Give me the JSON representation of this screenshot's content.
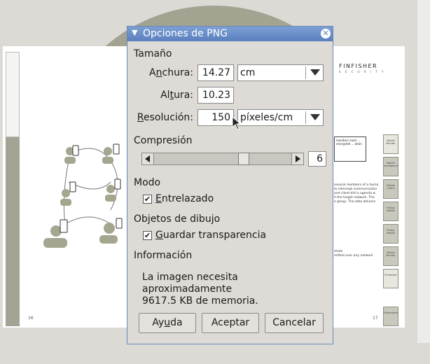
{
  "document": {
    "brand": "FINFISHER",
    "brand_sub": "S E C U R I T Y",
    "page_left_number": "16",
    "page_right_number": "17",
    "callout_text": "monitors most ... encrypted ... ation",
    "body_lines": [
      "several members of a huma",
      "to intercept communicatior",
      "and client did is agenda w",
      "h the target network. The",
      "e group. The data delivers"
    ],
    "small_lines": [
      "shots",
      "mitted over any network"
    ],
    "side_tabs": [
      "Mobile Monitor",
      "Mobile Intelligence",
      "Mobile Lawful",
      "FinSpy Mobile",
      "FinSpy Mobile",
      "Mobile Monitor",
      "FinTracker",
      "FinAnalyzer"
    ]
  },
  "dialog": {
    "title": "Opciones de PNG",
    "size_section": "Tamaño",
    "width_label_pre": "A",
    "width_label_u": "n",
    "width_label_post": "chura:",
    "width_value": "14.27",
    "width_unit": "cm",
    "height_label_pre": "Al",
    "height_label_u": "t",
    "height_label_post": "ura:",
    "height_value": "10.23",
    "res_label_pre": "",
    "res_label_u": "R",
    "res_label_post": "esolución:",
    "res_value": "150",
    "res_unit": "píxeles/cm",
    "compression_section": "Compresión",
    "compression_value": "6",
    "compression_fraction": 0.6667,
    "mode_section": "Modo",
    "interlace_pre": "",
    "interlace_u": "E",
    "interlace_post": "ntrelazado",
    "interlace_checked": true,
    "objects_section": "Objetos de dibujo",
    "transparency_pre": "",
    "transparency_u": "G",
    "transparency_post": "uardar transparencia",
    "transparency_checked": true,
    "info_section": "Información",
    "info_text_1": "La imagen necesita aproximadamente",
    "info_text_2": "9617.5 KB de memoria.",
    "help_pre": "Ay",
    "help_u": "u",
    "help_post": "da",
    "ok_label": "Aceptar",
    "cancel_label": "Cancelar",
    "check_mark": "✔"
  }
}
